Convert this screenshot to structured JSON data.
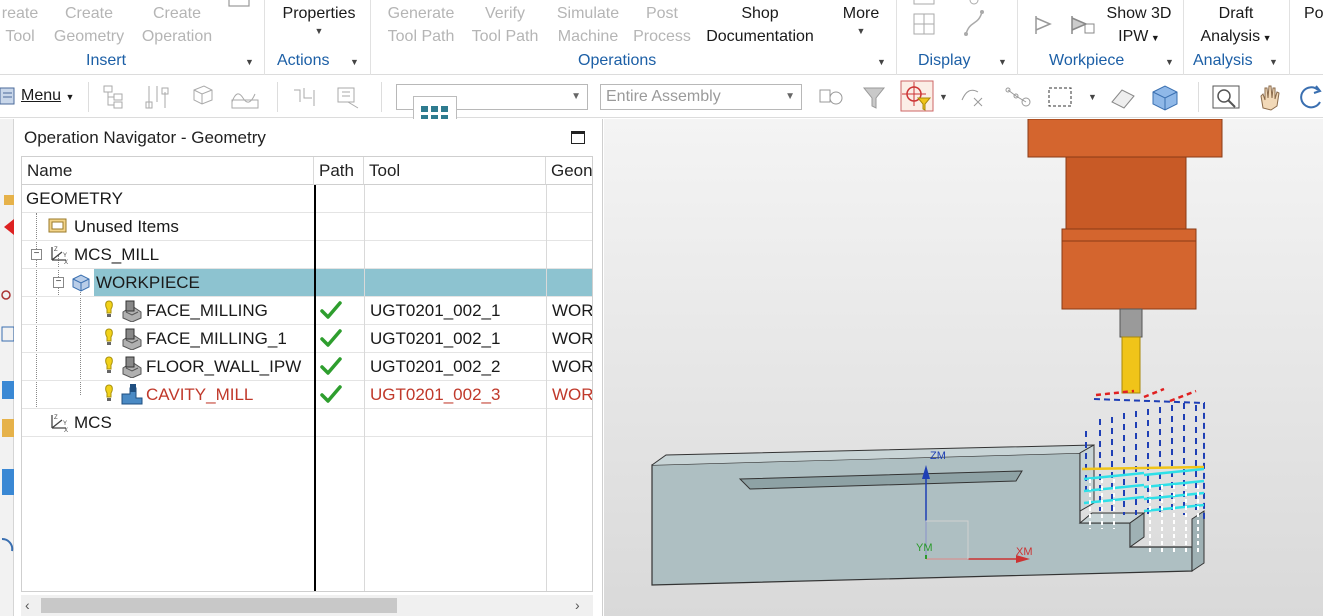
{
  "ribbon": {
    "insert": {
      "create_tool": [
        "reate",
        "Tool"
      ],
      "create_geometry": [
        "Create",
        "Geometry"
      ],
      "create_operation": [
        "Create",
        "Operation"
      ],
      "label": "Insert"
    },
    "actions": {
      "properties": "Properties",
      "label": "Actions"
    },
    "operations": {
      "generate": [
        "Generate",
        "Tool Path"
      ],
      "verify": [
        "Verify",
        "Tool Path"
      ],
      "simulate": [
        "Simulate",
        "Machine"
      ],
      "post": [
        "Post",
        "Process"
      ],
      "shop_doc": [
        "Shop",
        "Documentation"
      ],
      "more": "More",
      "label": "Operations"
    },
    "display": {
      "label": "Display"
    },
    "workpiece": {
      "show3d": [
        "Show 3D",
        "IPW"
      ],
      "label": "Workpiece"
    },
    "analysis": {
      "draft": [
        "Draft",
        "Analysis"
      ],
      "label": "Analysis",
      "partial": "Po"
    }
  },
  "toolbar": {
    "menu_label": "Menu",
    "filter_value": "",
    "assembly_value": "Entire Assembly"
  },
  "navigator": {
    "title": "Operation Navigator - Geometry",
    "columns": [
      "Name",
      "Path",
      "Tool",
      "Geon"
    ],
    "rows": [
      {
        "name": "GEOMETRY",
        "path": "",
        "tool": "",
        "geom": ""
      },
      {
        "name": "Unused Items",
        "path": "",
        "tool": "",
        "geom": ""
      },
      {
        "name": "MCS_MILL",
        "path": "",
        "tool": "",
        "geom": ""
      },
      {
        "name": "WORKPIECE",
        "path": "",
        "tool": "",
        "geom": ""
      },
      {
        "name": "FACE_MILLING",
        "path": "✔",
        "tool": "UGT0201_002_1",
        "geom": "WOR"
      },
      {
        "name": "FACE_MILLING_1",
        "path": "✔",
        "tool": "UGT0201_002_1",
        "geom": "WOR"
      },
      {
        "name": "FLOOR_WALL_IPW",
        "path": "✔",
        "tool": "UGT0201_002_2",
        "geom": "WOR"
      },
      {
        "name": "CAVITY_MILL",
        "path": "✔",
        "tool": "UGT0201_002_3",
        "geom": "WOR"
      },
      {
        "name": "MCS",
        "path": "",
        "tool": "",
        "geom": ""
      }
    ]
  },
  "viewport": {
    "axis_z": "ZM",
    "axis_y": "YM",
    "axis_x": "XM"
  },
  "colors": {
    "accent": "#1c5fa6",
    "selected_row": "#8dc3d0",
    "check_green": "#2e9e2e",
    "error_red": "#c0392b",
    "spindle_orange": "#d4652e",
    "tool_yellow": "#f0c419",
    "part_gray": "#aebfc2"
  },
  "icons": [
    "grid-apps-icon",
    "menu-icon",
    "warning-bulb-icon",
    "operation-icon",
    "workpiece-icon",
    "mcs-axis-icon",
    "folder-icon",
    "check-icon"
  ]
}
